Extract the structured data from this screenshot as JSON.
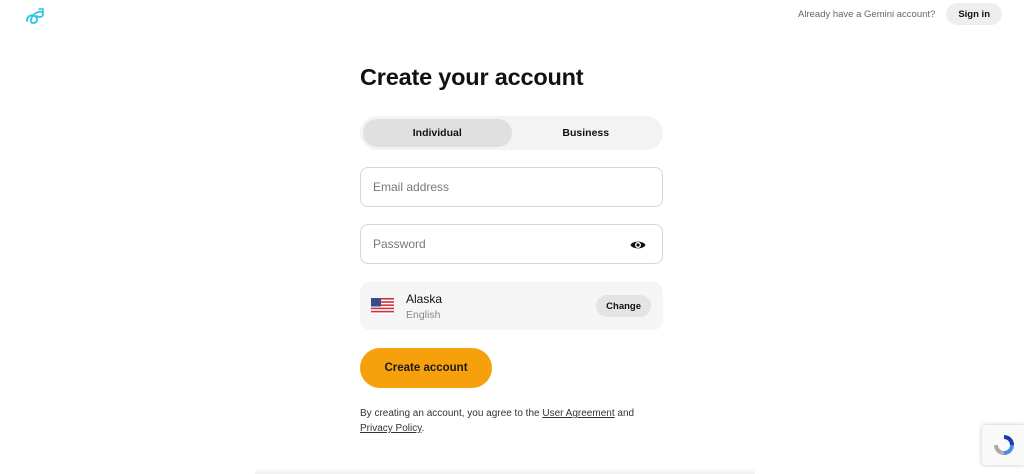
{
  "header": {
    "already_text": "Already have a Gemini account?",
    "signin_label": "Sign in",
    "logo_icon": "gemini-logo-icon"
  },
  "form": {
    "title": "Create your account",
    "account_types": [
      {
        "label": "Individual",
        "active": true
      },
      {
        "label": "Business",
        "active": false
      }
    ],
    "email_placeholder": "Email address",
    "password_placeholder": "Password",
    "password_toggle_icon": "eye-icon",
    "region": {
      "name": "Alaska",
      "language": "English",
      "flag_icon": "us-flag-icon",
      "change_label": "Change"
    },
    "submit_label": "Create account",
    "agreement": {
      "prefix": "By creating an account, you agree to the",
      "user_agreement": "User Agreement",
      "and": "and",
      "privacy_policy": "Privacy Policy",
      "suffix": "."
    }
  },
  "colors": {
    "accent": "#f6a10c",
    "logo": "#28c6e6"
  }
}
